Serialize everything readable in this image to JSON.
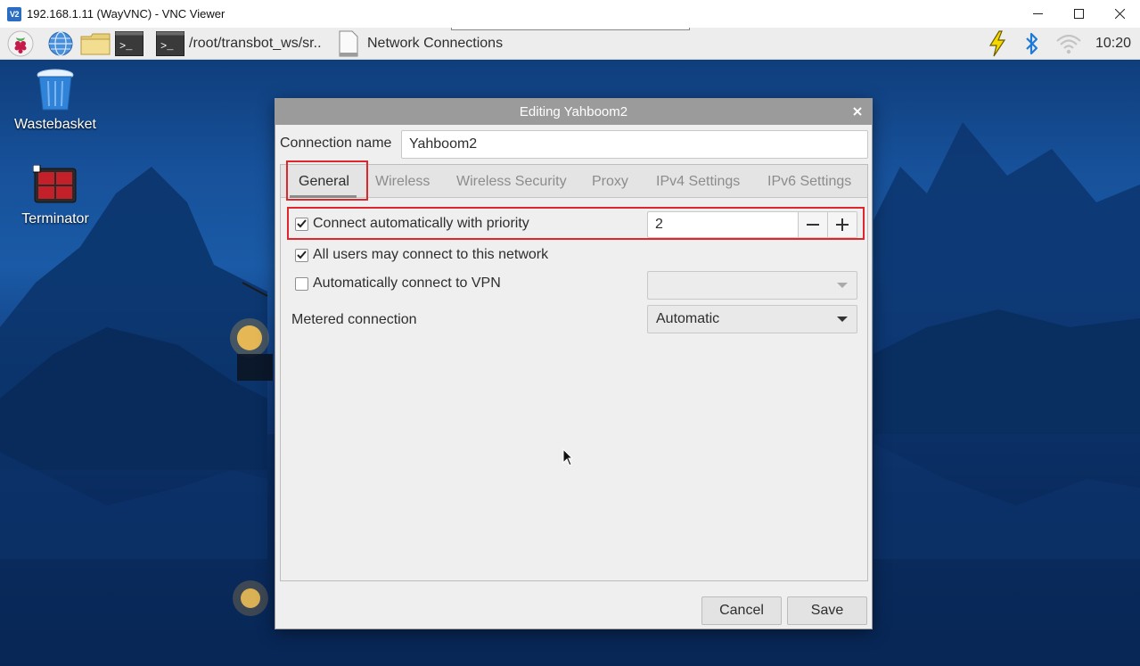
{
  "window": {
    "title": "192.168.1.11 (WayVNC) - VNC Viewer",
    "logo_text": "V2",
    "controls": [
      "minimize-icon",
      "maximize-icon",
      "close-icon"
    ]
  },
  "taskbar": {
    "terminal_path": "/root/transbot_ws/sr..",
    "active_window": "Network Connections",
    "clock": "10:20",
    "launchers": [
      "raspberry-menu-icon",
      "web-browser-icon",
      "file-manager-icon",
      "terminal-icon"
    ],
    "tray": [
      "power-warning-icon",
      "bluetooth-icon",
      "wifi-icon"
    ]
  },
  "desktop": {
    "icons": [
      {
        "label": "Wastebasket",
        "icon": "trash-icon"
      },
      {
        "label": "Terminator",
        "icon": "terminator-icon"
      }
    ]
  },
  "dialog": {
    "title": "Editing Yahboom2",
    "connection_name_label": "Connection name",
    "connection_name_value": "Yahboom2",
    "tabs": [
      {
        "label": "General",
        "active": true
      },
      {
        "label": "Wireless",
        "active": false
      },
      {
        "label": "Wireless Security",
        "active": false
      },
      {
        "label": "Proxy",
        "active": false
      },
      {
        "label": "IPv4 Settings",
        "active": false
      },
      {
        "label": "IPv6 Settings",
        "active": false
      }
    ],
    "general": {
      "auto_connect": {
        "label": "Connect automatically with priority",
        "checked": true,
        "priority": "2"
      },
      "all_users": {
        "label": "All users may connect to this network",
        "checked": true
      },
      "auto_vpn": {
        "label": "Automatically connect to VPN",
        "checked": false,
        "vpn_value": ""
      },
      "metered": {
        "label": "Metered connection",
        "value": "Automatic"
      }
    },
    "buttons": {
      "cancel": "Cancel",
      "save": "Save"
    }
  },
  "colors": {
    "highlight": "#e0262d",
    "dialog_titlebar": "#9b9b9b",
    "desktop": "#1a5aa6"
  }
}
